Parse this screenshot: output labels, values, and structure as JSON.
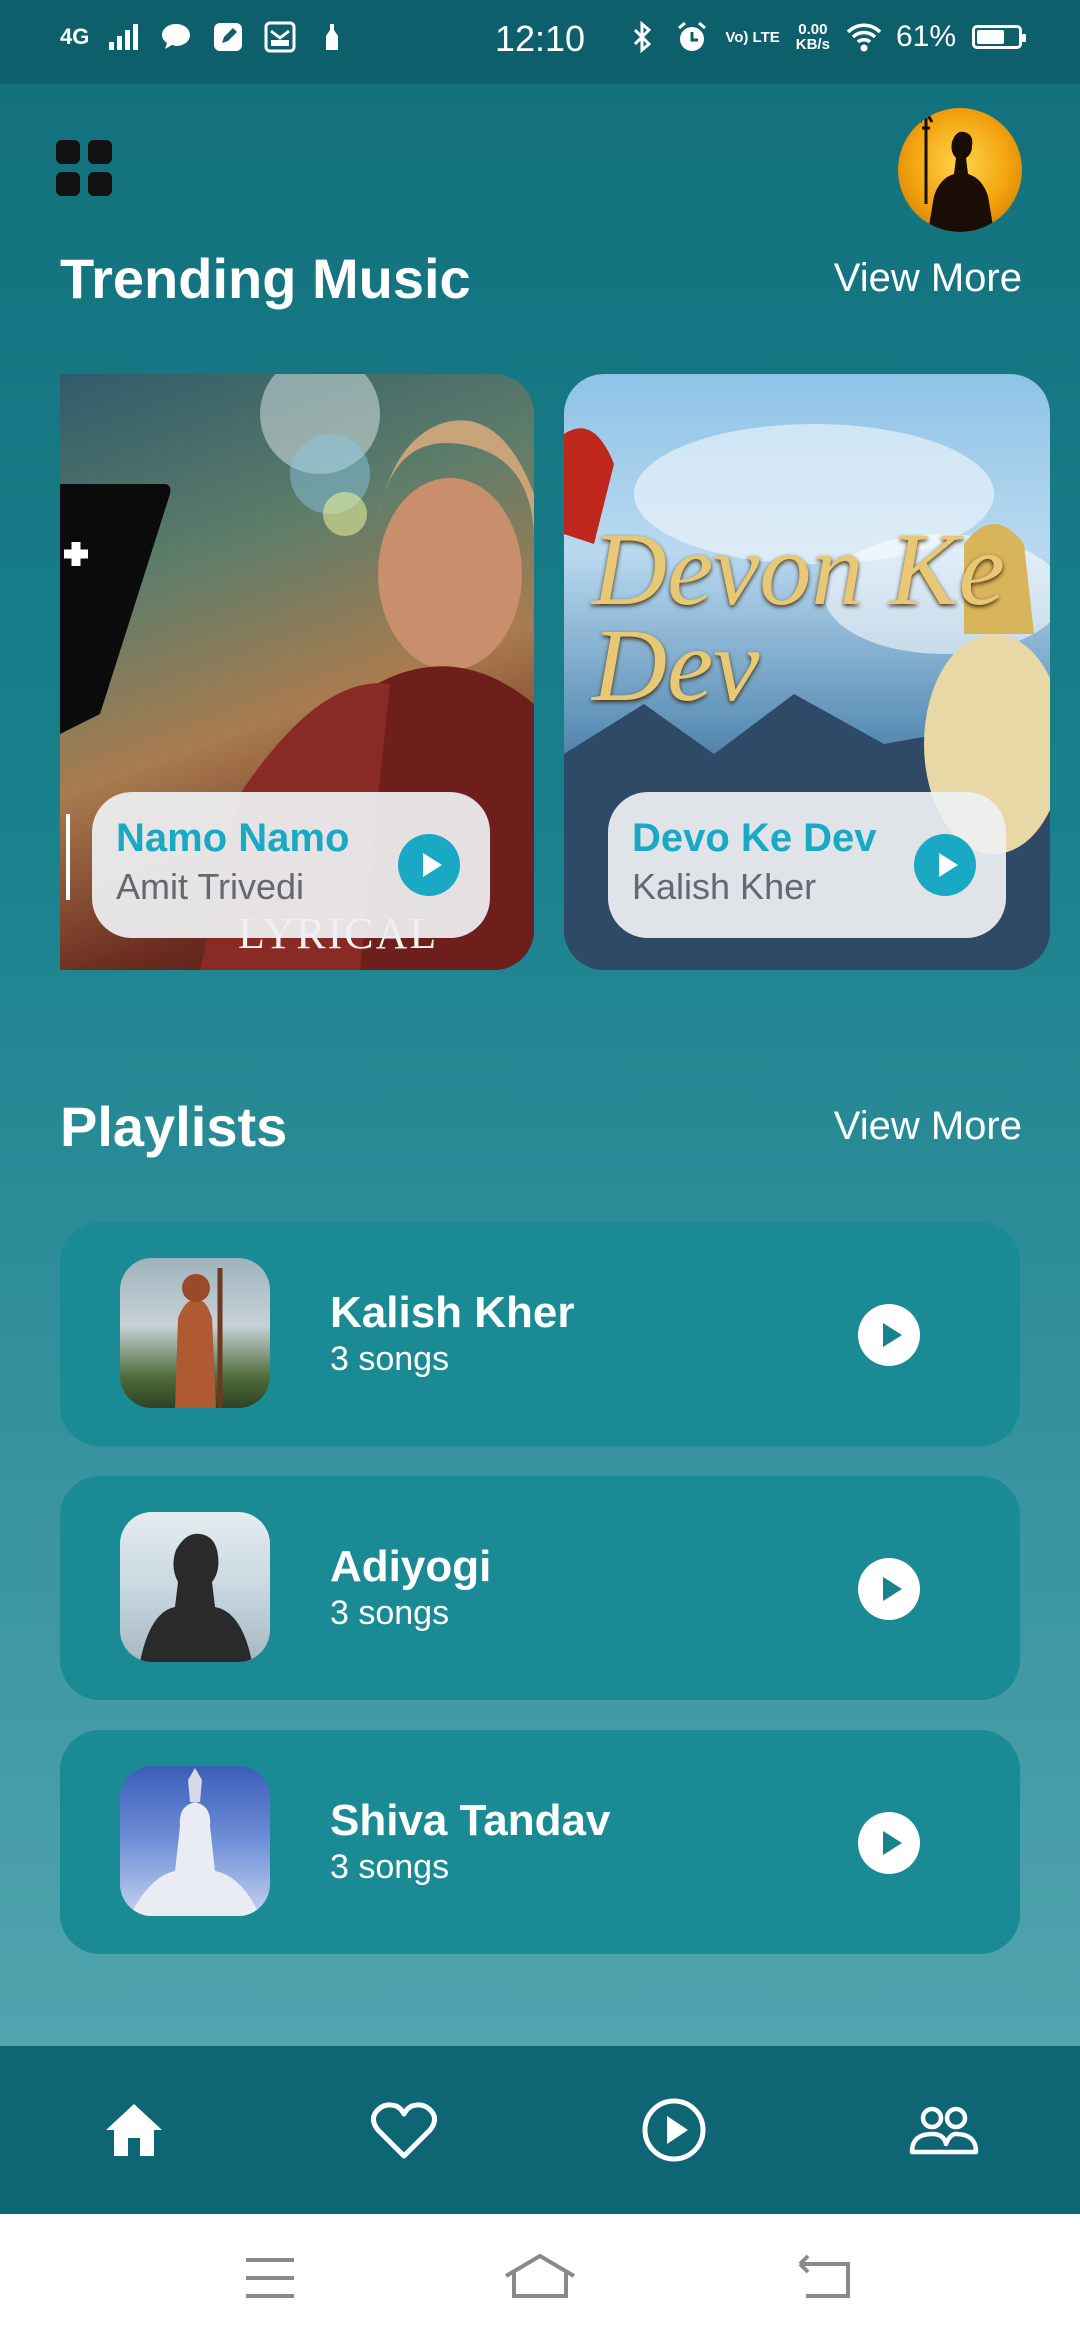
{
  "status_bar": {
    "network": "4G",
    "time": "12:10",
    "volte_label": "Vo) LTE",
    "speed_value": "0.00",
    "speed_unit": "KB/s",
    "battery": "61%"
  },
  "trending": {
    "title": "Trending Music",
    "view_more": "View More",
    "cards": [
      {
        "title": "Namo Namo",
        "artist": "Amit Trivedi",
        "art_overlay": "LYRICAL"
      },
      {
        "title": "Devo Ke Dev",
        "artist": "Kalish Kher",
        "art_overlay": "Devon Ke Dev"
      }
    ]
  },
  "playlists": {
    "title": "Playlists",
    "view_more": "View More",
    "items": [
      {
        "name": "Kalish Kher",
        "count": "3 songs"
      },
      {
        "name": "Adiyogi",
        "count": "3 songs"
      },
      {
        "name": "Shiva Tandav",
        "count": "3 songs"
      }
    ]
  },
  "bottom_nav": {
    "items": [
      "home-icon",
      "heart-icon",
      "play-circle-icon",
      "people-icon"
    ]
  },
  "system_nav": {
    "items": [
      "menu-icon",
      "home-outline-icon",
      "back-icon"
    ]
  },
  "colors": {
    "accent": "#1aa9c4",
    "row_bg": "#1a8b95",
    "nav_bg": "#0e6675"
  }
}
